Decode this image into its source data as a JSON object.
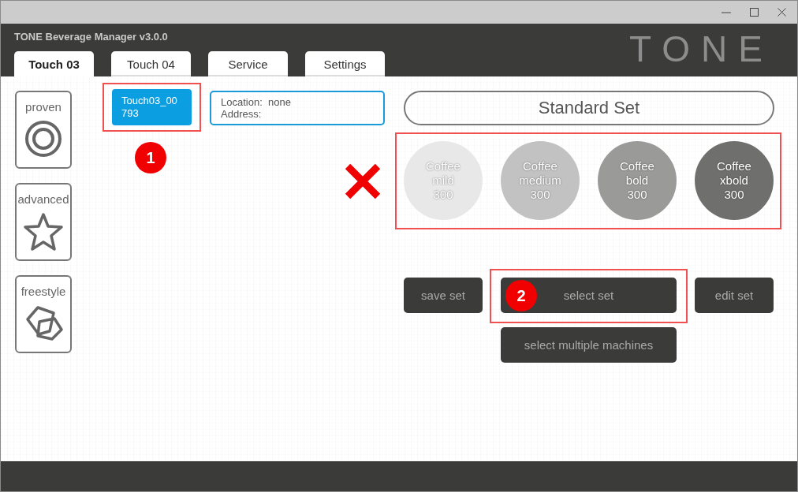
{
  "window": {
    "title": "TONE Beverage Manager v3.0.0",
    "logo": "TONE"
  },
  "tabs": [
    {
      "label": "Touch 03",
      "selected": true
    },
    {
      "label": "Touch 04",
      "selected": false
    },
    {
      "label": "Service",
      "selected": false
    },
    {
      "label": "Settings",
      "selected": false
    }
  ],
  "modes": [
    {
      "label": "proven",
      "kind": "target"
    },
    {
      "label": "advanced",
      "kind": "star"
    },
    {
      "label": "freestyle",
      "kind": "polygons"
    }
  ],
  "device": {
    "label": "Touch03_00793",
    "selected": true,
    "highlighted": true,
    "callout": "1"
  },
  "info": {
    "location": "Location:  none",
    "address": "Address:"
  },
  "set_name": "Standard Set",
  "beverages_panel": {
    "highlighted": true,
    "crossed_out": true
  },
  "beverages": [
    {
      "name": "Coffee",
      "strength": "mild",
      "amount": "300",
      "color": "#e8e8e8"
    },
    {
      "name": "Coffee",
      "strength": "medium",
      "amount": "300",
      "color": "#c2c2c2"
    },
    {
      "name": "Coffee",
      "strength": "bold",
      "amount": "300",
      "color": "#9a9a99"
    },
    {
      "name": "Coffee",
      "strength": "xbold",
      "amount": "300",
      "color": "#6f6f6e"
    }
  ],
  "buttons": [
    {
      "label": "save set",
      "highlighted": false
    },
    {
      "label": "select set",
      "highlighted": true,
      "callout": "2"
    },
    {
      "label": "edit set",
      "highlighted": false
    },
    {
      "label": "select multiple machines",
      "highlighted": false
    }
  ]
}
